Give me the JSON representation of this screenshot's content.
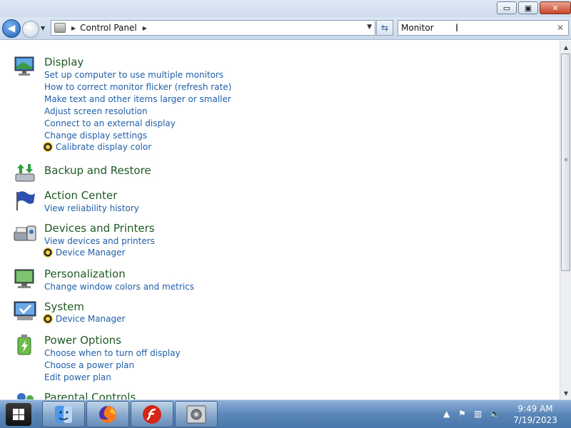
{
  "window": {
    "minimize_glyph": "▭",
    "maximize_glyph": "▣",
    "close_glyph": "✕"
  },
  "nav": {
    "breadcrumb": "Control Panel",
    "search_value": "Monitor"
  },
  "groups": [
    {
      "title": "Display",
      "icon": "display-icon",
      "links": [
        {
          "text": "Set up computer to use multiple monitors",
          "shield": false
        },
        {
          "text": "How to correct monitor flicker (refresh rate)",
          "shield": false
        },
        {
          "text": "Make text and other items larger or smaller",
          "shield": false
        },
        {
          "text": "Adjust screen resolution",
          "shield": false
        },
        {
          "text": "Connect to an external display",
          "shield": false
        },
        {
          "text": "Change display settings",
          "shield": false
        },
        {
          "text": "Calibrate display color",
          "shield": true
        }
      ]
    },
    {
      "title": "Backup and Restore",
      "icon": "backup-restore-icon",
      "links": []
    },
    {
      "title": "Action Center",
      "icon": "action-center-flag-icon",
      "links": [
        {
          "text": "View reliability history",
          "shield": false
        }
      ]
    },
    {
      "title": "Devices and Printers",
      "icon": "devices-printers-icon",
      "links": [
        {
          "text": "View devices and printers",
          "shield": false
        },
        {
          "text": "Device Manager",
          "shield": true
        }
      ]
    },
    {
      "title": "Personalization",
      "icon": "personalization-icon",
      "links": [
        {
          "text": "Change window colors and metrics",
          "shield": false
        }
      ]
    },
    {
      "title": "System",
      "icon": "system-icon",
      "links": [
        {
          "text": "Device Manager",
          "shield": true
        }
      ]
    },
    {
      "title": "Power Options",
      "icon": "power-options-icon",
      "links": [
        {
          "text": "Choose when to turn off display",
          "shield": false
        },
        {
          "text": "Choose a power plan",
          "shield": false
        },
        {
          "text": "Edit power plan",
          "shield": false
        }
      ]
    },
    {
      "title": "Parental Controls",
      "icon": "parental-controls-icon",
      "links": []
    }
  ],
  "taskbar": {
    "apps": [
      {
        "name": "finder-icon"
      },
      {
        "name": "firefox-icon"
      },
      {
        "name": "flash-icon"
      },
      {
        "name": "control-panel-icon"
      }
    ],
    "time": "9:49 AM",
    "date": "7/19/2023"
  },
  "colors": {
    "group_title": "#1e5a23",
    "link": "#1f5fa8"
  }
}
